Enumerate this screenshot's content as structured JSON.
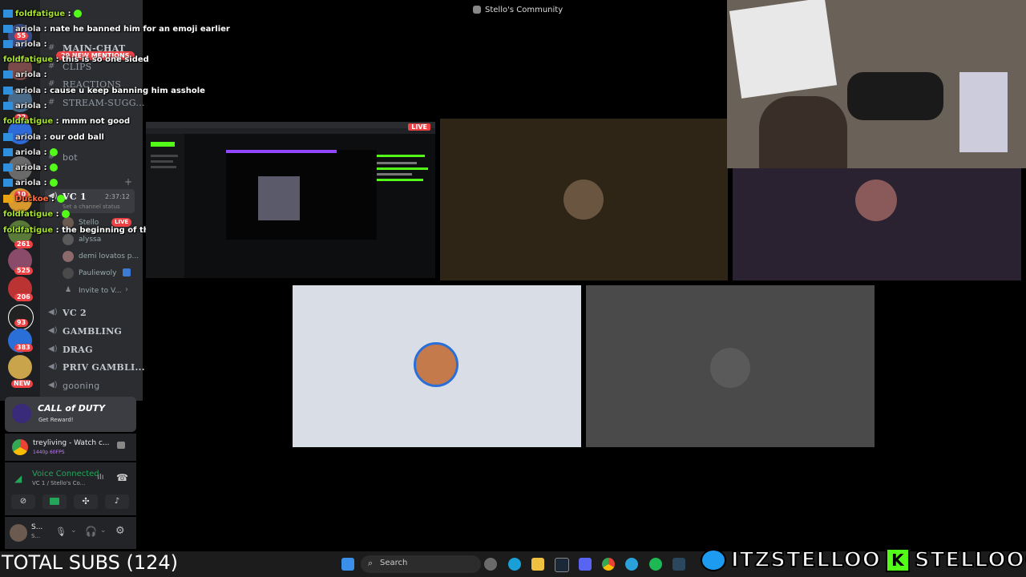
{
  "window": {
    "title": "Stello's Community"
  },
  "server_badges": [
    "55",
    "29",
    "22",
    "10",
    "261",
    "525",
    "206",
    "93",
    "383",
    "NEW"
  ],
  "channels": {
    "main_chat": "MAIN-CHAT",
    "new_mentions": "29 NEW MENTIONS",
    "clips": "CLIPS",
    "reactions": "REACTIONS",
    "stream_sugg": "STREAM-SUGG...",
    "bot": "bot",
    "vc1": "VC 1",
    "vc1_timer": "2:37:12",
    "channel_status": "Set a channel status",
    "vc2": "VC 2",
    "gambling": "GAMBLING",
    "drag": "DRAG",
    "priv_gambling": "PRIV GAMBLI...",
    "gooning": "gooning"
  },
  "vc_users": [
    {
      "name": "Stello",
      "live": "LIVE"
    },
    {
      "name": "alyssa"
    },
    {
      "name": "demi lovatos p..."
    },
    {
      "name": "Pauliewoly"
    },
    {
      "name": "Invite to V..."
    }
  ],
  "chat": [
    {
      "user": "foldfatigue",
      "msg": ""
    },
    {
      "user": "ariola",
      "msg": "nate he banned him for an emoji earlier"
    },
    {
      "user": "ariola",
      "msg": ""
    },
    {
      "user": "foldfatigue",
      "msg": "this is so one sided"
    },
    {
      "user": "ariola",
      "msg": ""
    },
    {
      "user": "ariola",
      "msg": "cause u keep banning him asshole"
    },
    {
      "user": "ariola",
      "msg": ""
    },
    {
      "user": "foldfatigue",
      "msg": "mmm not good"
    },
    {
      "user": "ariola",
      "msg": "our odd ball"
    },
    {
      "user": "ariola",
      "msg": ""
    },
    {
      "user": "ariola",
      "msg": ""
    },
    {
      "user": "ariola",
      "msg": ""
    },
    {
      "user": "Duckoe",
      "msg": ""
    },
    {
      "user": "foldfatigue",
      "msg": ""
    },
    {
      "user": "foldfatigue",
      "msg": "the beginning of this stream"
    }
  ],
  "promo": {
    "title": "CALL of DUTY",
    "sub": "Get Reward!"
  },
  "activity": {
    "title": "treyliving - Watch c...",
    "sub": "1440p 60FPS"
  },
  "voice": {
    "status": "Voice Connected",
    "sub": "VC 1 / Stello's Co..."
  },
  "user": {
    "name": "S...",
    "sub": "S..."
  },
  "stream": {
    "live_badge": "LIVE"
  },
  "taskbar": {
    "search_placeholder": "Search"
  },
  "overlay": {
    "total_subs": "TOTAL SUBS (124)",
    "twitter": "ITZSTELLOO",
    "kick": "STELLOOO"
  },
  "colors": {
    "kick_green": "#53fc18",
    "discord_blurple": "#5865f2",
    "live_red": "#ed4245"
  }
}
